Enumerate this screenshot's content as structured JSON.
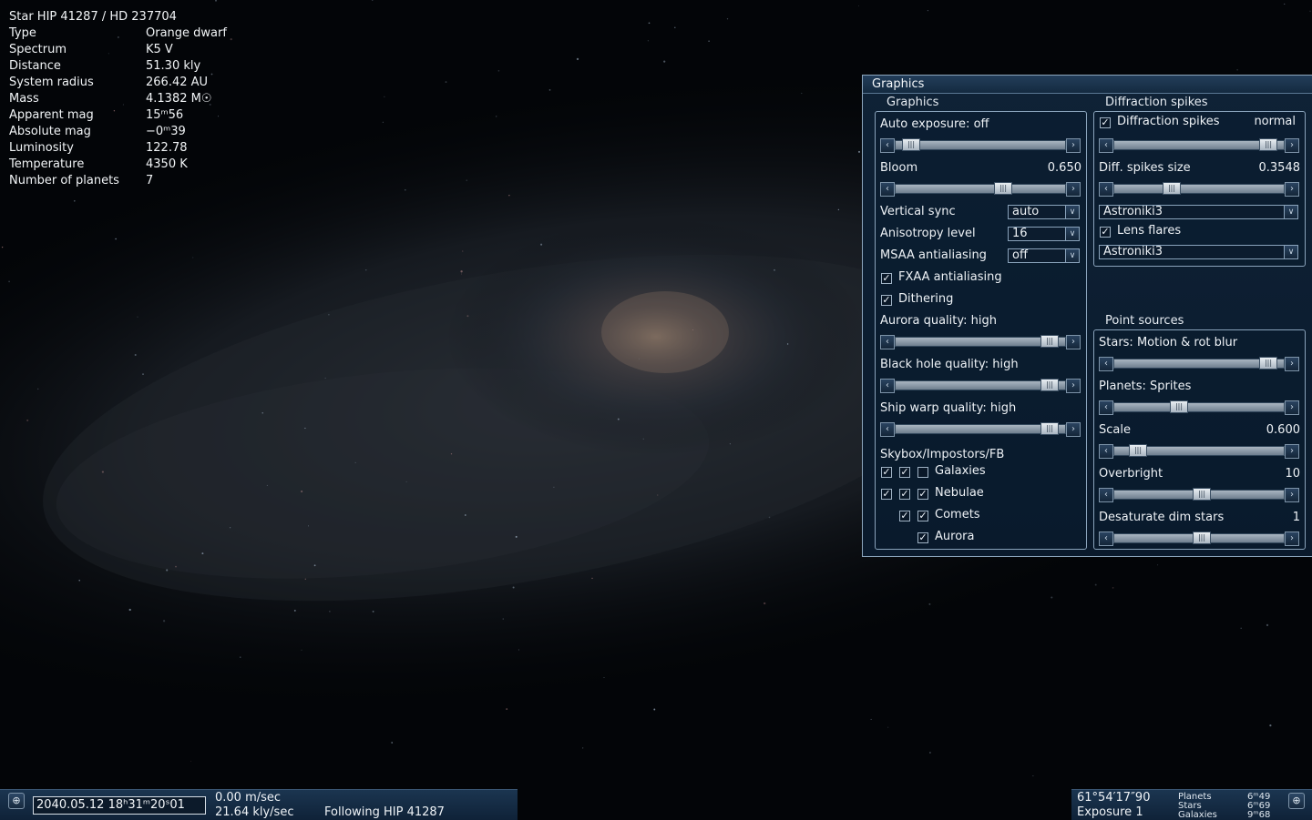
{
  "star_info": {
    "title": "Star  HIP 41287 / HD 237704",
    "rows": [
      {
        "key": "Type",
        "value": "Orange dwarf"
      },
      {
        "key": "Spectrum",
        "value": "K5 V"
      },
      {
        "key": "Distance",
        "value": "51.30 kly"
      },
      {
        "key": "System radius",
        "value": "266.42 AU"
      },
      {
        "key": "Mass",
        "value": "4.1382 M☉"
      },
      {
        "key": "Apparent mag",
        "value": "15ᵐ56"
      },
      {
        "key": "Absolute mag",
        "value": "−0ᵐ39"
      },
      {
        "key": "Luminosity",
        "value": "122.78"
      },
      {
        "key": "Temperature",
        "value": "4350 K"
      },
      {
        "key": "Number of planets",
        "value": "7"
      }
    ]
  },
  "window": {
    "title": "Graphics",
    "graphics": {
      "label": "Graphics",
      "auto_exposure": "Auto exposure: off",
      "auto_exposure_pos": 0.05,
      "bloom_label": "Bloom",
      "bloom_value": "0.650",
      "bloom_pos": 0.65,
      "vsync_label": "Vertical sync",
      "vsync_value": "auto",
      "aniso_label": "Anisotropy level",
      "aniso_value": "16",
      "msaa_label": "MSAA antialiasing",
      "msaa_value": "off",
      "fxaa_label": "FXAA antialiasing",
      "fxaa_checked": true,
      "dithering_label": "Dithering",
      "dithering_checked": true,
      "aurora_label": "Aurora quality: high",
      "aurora_pos": 0.95,
      "blackhole_label": "Black hole quality: high",
      "blackhole_pos": 0.95,
      "shipwarp_label": "Ship warp quality: high",
      "shipwarp_pos": 0.95,
      "skybox_label": "Skybox/Impostors/FB",
      "galaxies_label": "Galaxies",
      "nebulae_label": "Nebulae",
      "comets_label": "Comets",
      "aurora_cb_label": "Aurora"
    },
    "diffraction": {
      "label": "Diffraction spikes",
      "spikes_label": "Diffraction spikes",
      "spikes_mode": "normal",
      "spikes_checked": true,
      "spikes_pos": 0.95,
      "size_label": "Diff. spikes size",
      "size_value": "0.3548",
      "size_pos": 0.32,
      "spikes_preset": "Astroniki3",
      "lens_flares_label": "Lens flares",
      "lens_flares_checked": true,
      "flares_preset": "Astroniki3"
    },
    "point_sources": {
      "label": "Point sources",
      "stars_label": "Stars: Motion & rot blur",
      "stars_pos": 0.95,
      "planets_label": "Planets: Sprites",
      "planets_pos": 0.37,
      "scale_label": "Scale",
      "scale_value": "0.600",
      "scale_pos": 0.1,
      "overbright_label": "Overbright",
      "overbright_value": "10",
      "overbright_pos": 0.52,
      "desat_label": "Desaturate dim stars",
      "desat_value": "1",
      "desat_pos": 0.52
    }
  },
  "bottom_left": {
    "datetime": "2040.05.12  18ʰ31ᵐ20ˢ01",
    "speed1": "0.00  m/sec",
    "speed2": "21.64  kly/sec",
    "following": "Following  HIP  41287"
  },
  "bottom_right": {
    "coords": "61°54′17″90",
    "exposure": "Exposure  1",
    "planets_label": "Planets",
    "planets_value": "6ᵐ49",
    "stars_label": "Stars",
    "stars_value": "6ᵐ69",
    "galaxies_label": "Galaxies",
    "galaxies_value": "9ᵐ68"
  }
}
